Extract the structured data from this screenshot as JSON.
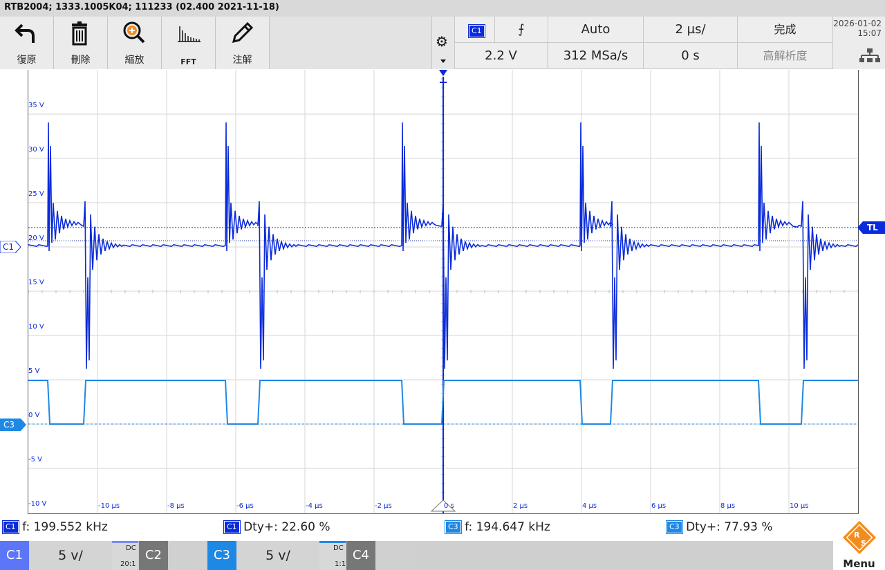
{
  "title": "RTB2004; 1333.1005K04; 111233 (02.400 2021-11-18)",
  "toolbar": {
    "undo": "復原",
    "delete": "刪除",
    "zoom": "縮放",
    "fft": "FFT",
    "annotate": "注解"
  },
  "trigger": {
    "source": "C1",
    "slope_icon": "rising-edge-icon",
    "mode": "Auto",
    "level": "2.2 V",
    "sample_rate": "312 MSa/s"
  },
  "timebase": {
    "scale": "2 µs/",
    "position": "0 s"
  },
  "acquisition": {
    "state": "完成",
    "mode": "高解析度"
  },
  "datetime": {
    "date": "2026-01-02",
    "time": "15:07"
  },
  "plot": {
    "y_labels": [
      "35 V",
      "30 V",
      "25 V",
      "20 V",
      "15 V",
      "10 V",
      "5 V",
      "0 V",
      "-5 V",
      "-10 V"
    ],
    "x_labels": [
      "-10 µs",
      "-8 µs",
      "-6 µs",
      "-4 µs",
      "-2 µs",
      "0 s",
      "2 µs",
      "4 µs",
      "6 µs",
      "8 µs",
      "10 µs"
    ],
    "markers": {
      "c1": "C1",
      "c3": "C3",
      "tl": "TL"
    }
  },
  "measurements": [
    {
      "channel": "C1",
      "label": "f: 199.552 kHz"
    },
    {
      "channel": "C1",
      "label": "Dty+: 22.60 %"
    },
    {
      "channel": "C3",
      "label": "f: 194.647 kHz"
    },
    {
      "channel": "C3",
      "label": "Dty+: 77.93 %"
    }
  ],
  "channels": [
    {
      "name": "C1",
      "scale": "5 v/",
      "coupling": "DC",
      "probe": "20:1"
    },
    {
      "name": "C2"
    },
    {
      "name": "C3",
      "scale": "5 v/",
      "coupling": "DC",
      "probe": "1:1"
    },
    {
      "name": "C4"
    }
  ],
  "menu": "Menu",
  "colors": {
    "c1": "#0a2bd9",
    "c3": "#1e88e5"
  }
}
